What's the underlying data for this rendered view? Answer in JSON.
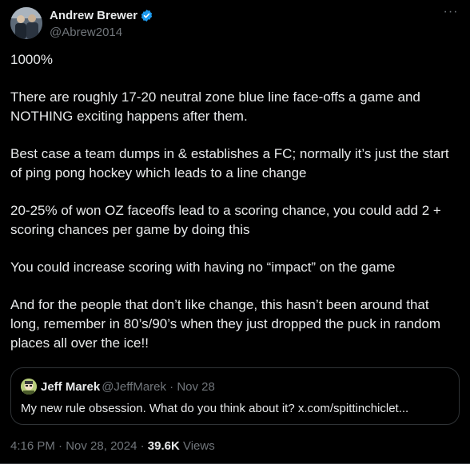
{
  "author": {
    "display_name": "Andrew Brewer",
    "handle": "@Abrew2014",
    "avatar_icon": "profile-photo",
    "verified_icon": "verified-badge-icon",
    "verified_color": "#1d9bf0"
  },
  "more_icon": "more-options-icon",
  "paragraphs": [
    "1000%",
    "There are roughly 17-20 neutral zone blue line face-offs a game and NOTHING exciting happens after them.",
    "Best case a team dumps in & establishes a FC; normally it’s just the start of ping pong hockey which leads to a line change",
    "20-25% of won OZ faceoffs lead to a scoring chance, you could add 2 + scoring chances per game by doing this",
    "You could increase scoring with having no “impact” on the game",
    "And for the people that don’t like change, this hasn’t been around that long, remember in 80’s/90’s when they just dropped the puck in random places all over the ice!!"
  ],
  "quote": {
    "display_name": "Jeff Marek",
    "handle_date": "@JeffMarek · Nov 28",
    "text": "My new rule obsession. What do you think about it? x.com/spittinchiclet..."
  },
  "meta": {
    "time": "4:16 PM",
    "sep1": " · ",
    "date": "Nov 28, 2024",
    "sep2": " · ",
    "views_count": "39.6K",
    "views_label": " Views"
  },
  "colors": {
    "background": "#000000",
    "text": "#e7e9ea",
    "muted": "#71767b",
    "border": "#2f3336"
  }
}
